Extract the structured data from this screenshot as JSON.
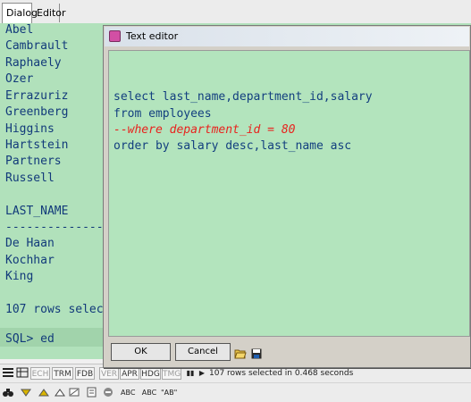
{
  "tabs": [
    {
      "label": "Dialog"
    },
    {
      "label": "Editor"
    }
  ],
  "output_lines": [
    "Abel",
    "Cambrault",
    "Raphaely",
    "Ozer",
    "Errazuriz",
    "Greenberg",
    "Higgins",
    "Hartstein",
    "Partners",
    "Russell",
    "",
    "LAST_NAME",
    "----------------",
    "De Haan",
    "Kochhar",
    "King",
    "",
    "107 rows selec",
    "",
    "SQL> ed"
  ],
  "editor": {
    "title": "Text editor",
    "code_lines": [
      {
        "text": "select last_name,department_id,salary",
        "kind": "code"
      },
      {
        "text": "from employees",
        "kind": "code"
      },
      {
        "text": "--where department_id = 80",
        "kind": "comment"
      },
      {
        "text": "order by salary desc,last_name asc",
        "kind": "code"
      }
    ],
    "ok_label": "OK",
    "cancel_label": "Cancel"
  },
  "status": {
    "items": [
      {
        "label": "ECH",
        "dim": true
      },
      {
        "label": "TRM",
        "dim": false
      },
      {
        "label": "FDB",
        "dim": false
      },
      {
        "label": "VER",
        "dim": true
      },
      {
        "label": "APR",
        "dim": false
      },
      {
        "label": "HDG",
        "dim": false
      },
      {
        "label": "TMG",
        "dim": true
      }
    ],
    "message": "107 rows selected in 0.468 seconds"
  },
  "toolbar": {
    "icons": [
      "binoculars-icon",
      "triangle-down-icon",
      "triangle-up-icon",
      "eraser-icon",
      "no-entry-icon",
      "cancel-icon",
      "spellcheck-icon",
      "abc-icon",
      "uppercase-abc-icon",
      "quoted-ab-icon"
    ],
    "abc_label": "ABC",
    "abc2_label": "ABC",
    "ab_label": "\"AB\""
  },
  "colors": {
    "editor_bg": "#b3e4bd",
    "output_bg": "#b1e1bb",
    "code_text": "#133f7f",
    "comment_text": "#e8231e"
  }
}
